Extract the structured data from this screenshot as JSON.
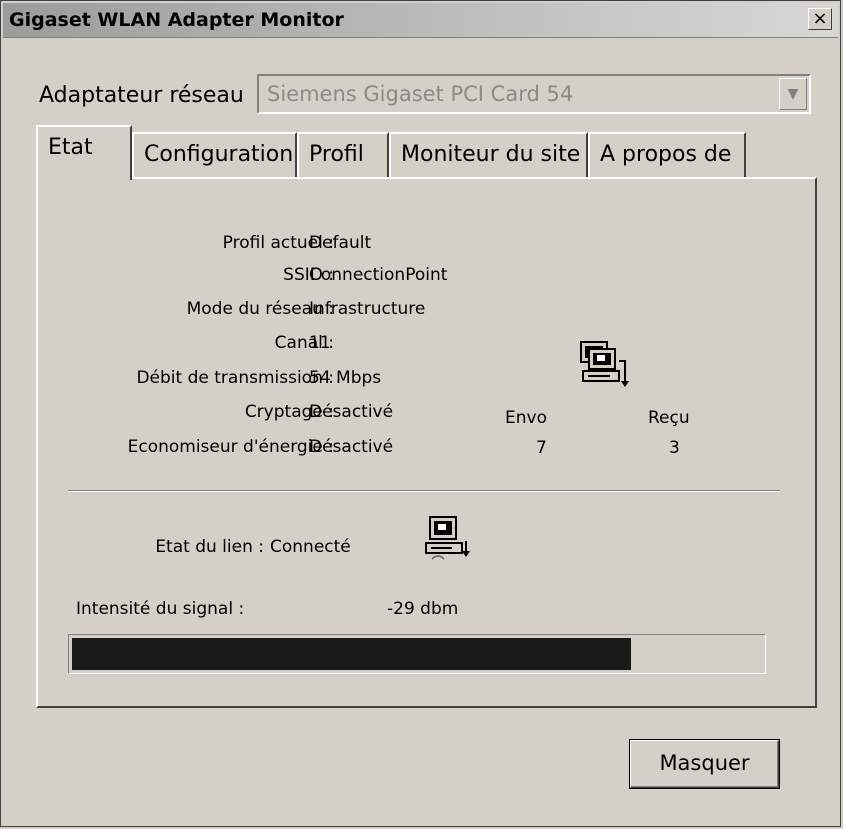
{
  "window": {
    "title": "Gigaset WLAN Adapter Monitor",
    "close_glyph": "×"
  },
  "adapter": {
    "label": "Adaptateur réseau",
    "value": "Siemens Gigaset PCI Card 54",
    "dropdown_glyph": "▼"
  },
  "tabs": [
    {
      "label": "Etat",
      "active": true
    },
    {
      "label": "Configuration",
      "active": false
    },
    {
      "label": "Profil",
      "active": false
    },
    {
      "label": "Moniteur du site",
      "active": false
    },
    {
      "label": "A propos de",
      "active": false
    }
  ],
  "status": {
    "rows": [
      {
        "label": "Profil actuel :",
        "value": "Default"
      },
      {
        "label": "SSID :",
        "value": "ConnectionPoint"
      },
      {
        "label": "Mode du réseau :",
        "value": "Infrastructure"
      },
      {
        "label": "Canal :",
        "value": "11"
      },
      {
        "label": "Débit de transmission :",
        "value": "54 Mbps"
      },
      {
        "label": "Cryptage :",
        "value": "Désactivé"
      },
      {
        "label": "Economiseur d'énergie :",
        "value": "Désactivé"
      }
    ],
    "sent_label": "Envo",
    "received_label": "Reçu",
    "sent_value": "7",
    "received_value": "3",
    "link_label": "Etat du lien :",
    "link_value": "Connecté",
    "signal_label": "Intensité du signal :",
    "signal_value": "-29 dbm",
    "signal_fraction": 0.81
  },
  "buttons": {
    "hide": "Masquer"
  }
}
